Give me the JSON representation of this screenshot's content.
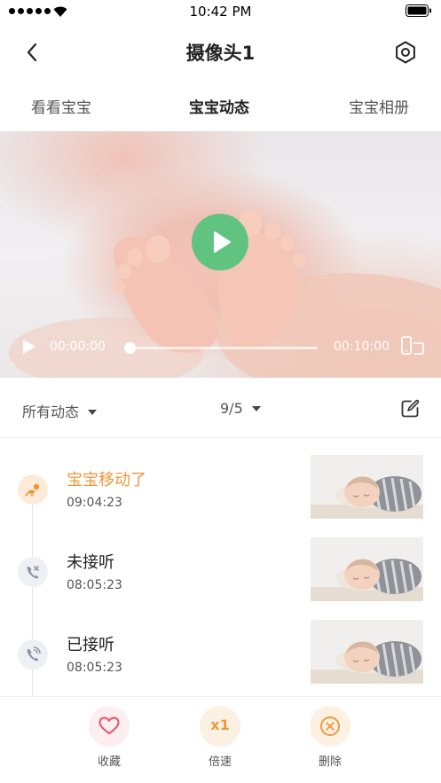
{
  "status_bar": {
    "time": "10:42 PM"
  },
  "nav": {
    "title": "摄像头1"
  },
  "tabs": [
    {
      "label": "看看宝宝",
      "active": false
    },
    {
      "label": "宝宝动态",
      "active": true
    },
    {
      "label": "宝宝相册",
      "active": false
    }
  ],
  "player": {
    "current_time": "00:00:00",
    "total_time": "00:10:00",
    "progress": 0,
    "accent": "#60c480"
  },
  "filter": {
    "category": "所有动态",
    "date": "9/5"
  },
  "events": [
    {
      "name": "宝宝移动了",
      "time": "09:04:23",
      "icon": "baby-crawl-icon",
      "highlight": true,
      "accent": "#f0963a"
    },
    {
      "name": "未接听",
      "time": "08:05:23",
      "icon": "missed-call-icon",
      "highlight": false
    },
    {
      "name": "已接听",
      "time": "08:05:23",
      "icon": "answered-call-icon",
      "highlight": false
    }
  ],
  "actions": [
    {
      "label": "收藏",
      "icon": "heart-icon",
      "color": "#e8536a"
    },
    {
      "label": "倍速",
      "icon_text": "x1",
      "color": "#ee9b3c"
    },
    {
      "label": "删除",
      "icon": "close-circle-icon",
      "color": "#ee9b3c"
    }
  ]
}
